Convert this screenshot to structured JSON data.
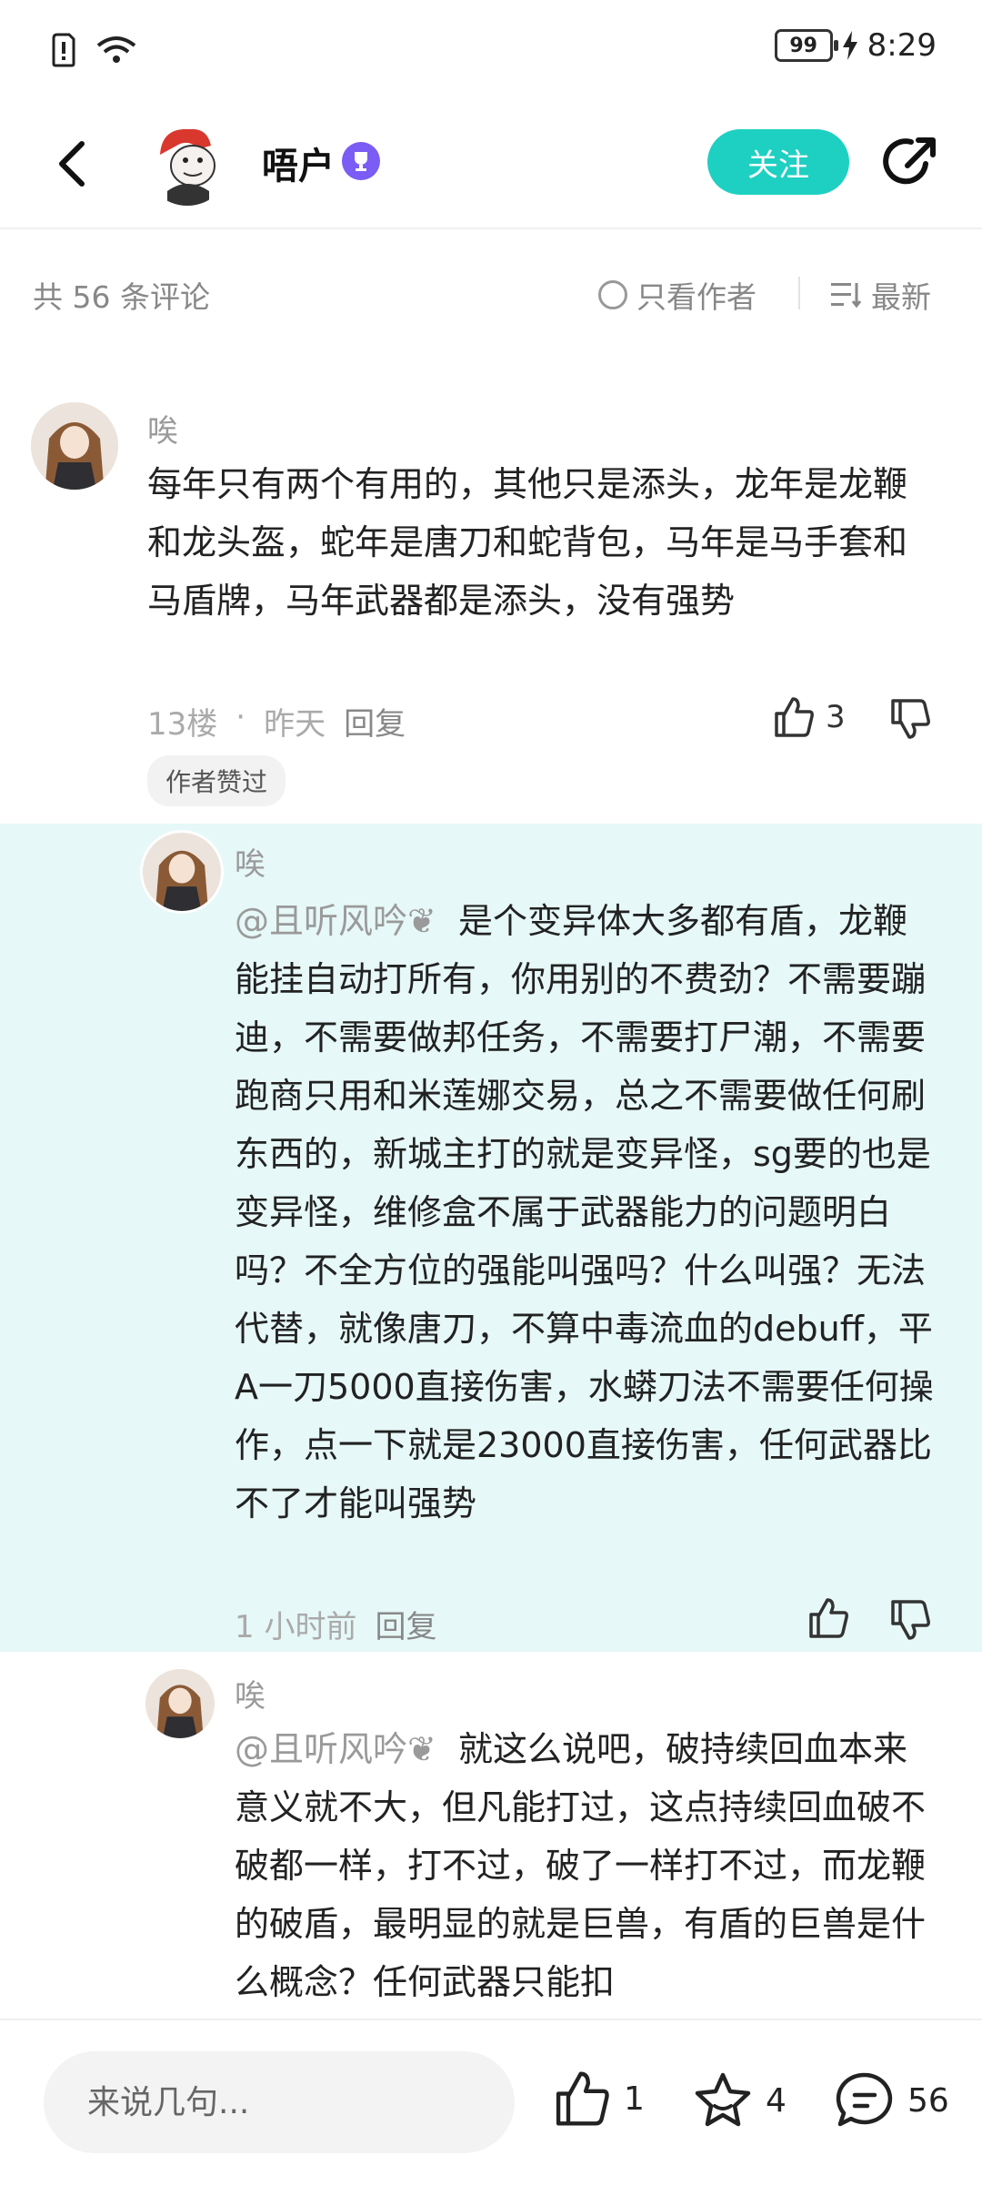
{
  "status_bar": {
    "battery": "99",
    "time": "8:29"
  },
  "header": {
    "username": "唔户",
    "follow_label": "关注"
  },
  "filter": {
    "count_text": "共 56 条评论",
    "author_only_label": "只看作者",
    "sort_label": "最新"
  },
  "comments": [
    {
      "author": "唉",
      "text": "每年只有两个有用的，其他只是添头，龙年是龙鞭和龙头盔，蛇年是唐刀和蛇背包，马年是马手套和马盾牌，马年武器都是添头，没有强势",
      "floor": "13楼",
      "dot": "·",
      "time": "昨天",
      "reply_label": "回复",
      "likes": "3",
      "tag": "作者赞过"
    },
    {
      "author": "唉",
      "mention": "@且听风吟❦",
      "text": "是个变异体大多都有盾，龙鞭能挂自动打所有，你用别的不费劲？不需要蹦迪，不需要做邦任务，不需要打尸潮，不需要跑商只用和米莲娜交易，总之不需要做任何刷东西的，新城主打的就是变异怪，sg要的也是变异怪，维修盒不属于武器能力的问题明白吗？不全方位的强能叫强吗？什么叫强？无法代替，就像唐刀，不算中毒流血的debuff，平A一刀5000直接伤害，水蟒刀法不需要任何操作，点一下就是23000直接伤害，任何武器比不了才能叫强势",
      "time": "1 小时前",
      "reply_label": "回复"
    },
    {
      "author": "唉",
      "mention": "@且听风吟❦",
      "text": "就这么说吧，破持续回血本来意义就不大，但凡能打过，这点持续回血破不破都一样，打不过，破了一样打不过，而龙鞭的破盾，最明显的就是巨兽，有盾的巨兽是什么概念？任何武器只能扣"
    }
  ],
  "bottom_bar": {
    "input_placeholder": "来说几句...",
    "likes": "1",
    "favorites": "4",
    "comments": "56"
  }
}
